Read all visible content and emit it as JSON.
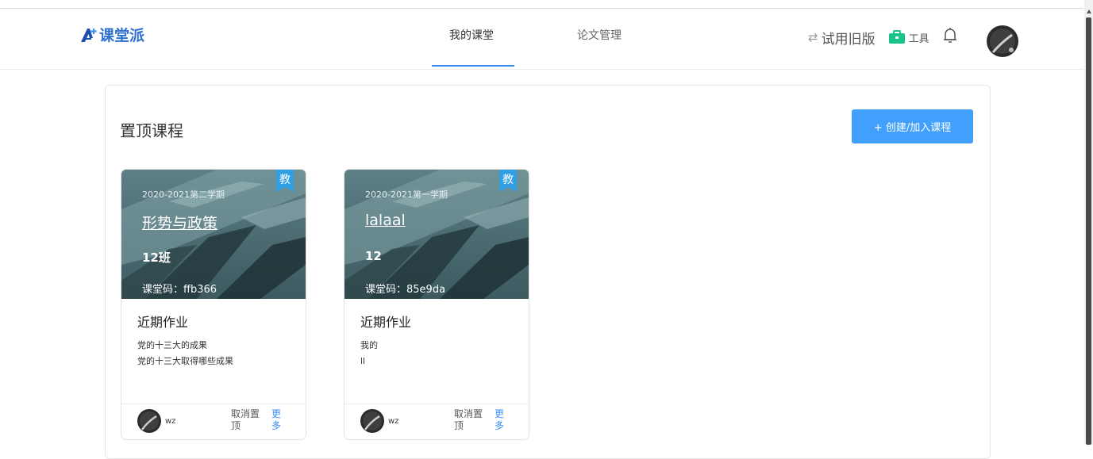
{
  "header": {
    "logo_text": "课堂派",
    "tabs": [
      {
        "label": "我的课堂",
        "active": true
      },
      {
        "label": "论文管理",
        "active": false
      }
    ],
    "switch_old_label": "试用旧版",
    "tools_label": "工具",
    "icons": {
      "logo": "logo-a-plus-icon",
      "switch": "swap-arrows-icon",
      "tools": "briefcase-icon",
      "bell": "bell-icon",
      "avatar": "user-avatar"
    }
  },
  "main": {
    "section_title": "置顶课程",
    "create_button_label": "+ 创建/加入课程"
  },
  "courses": [
    {
      "badge": "教",
      "term": "2020-2021第二学期",
      "name": "形势与政策",
      "class_name": "12班",
      "code_label": "课堂码：",
      "code": "ffb366",
      "recent_title": "近期作业",
      "homework": [
        "党的十三大的成果",
        "党的十三大取得哪些成果"
      ],
      "owner": "wz",
      "unpin_label": "取消置顶",
      "more_label": "更多"
    },
    {
      "badge": "教",
      "term": "2020-2021第一学期",
      "name": "lalaal",
      "class_name": "12",
      "code_label": "课堂码：",
      "code": "85e9da",
      "recent_title": "近期作业",
      "homework": [
        "我的",
        "ll"
      ],
      "owner": "wz",
      "unpin_label": "取消置顶",
      "more_label": "更多"
    }
  ],
  "colors": {
    "accent": "#42a0fd",
    "tab_underline": "#3d8ef5",
    "badge": "#2f9fe6",
    "tools_icon": "#16c48a",
    "logo": "#2f6fd0"
  }
}
